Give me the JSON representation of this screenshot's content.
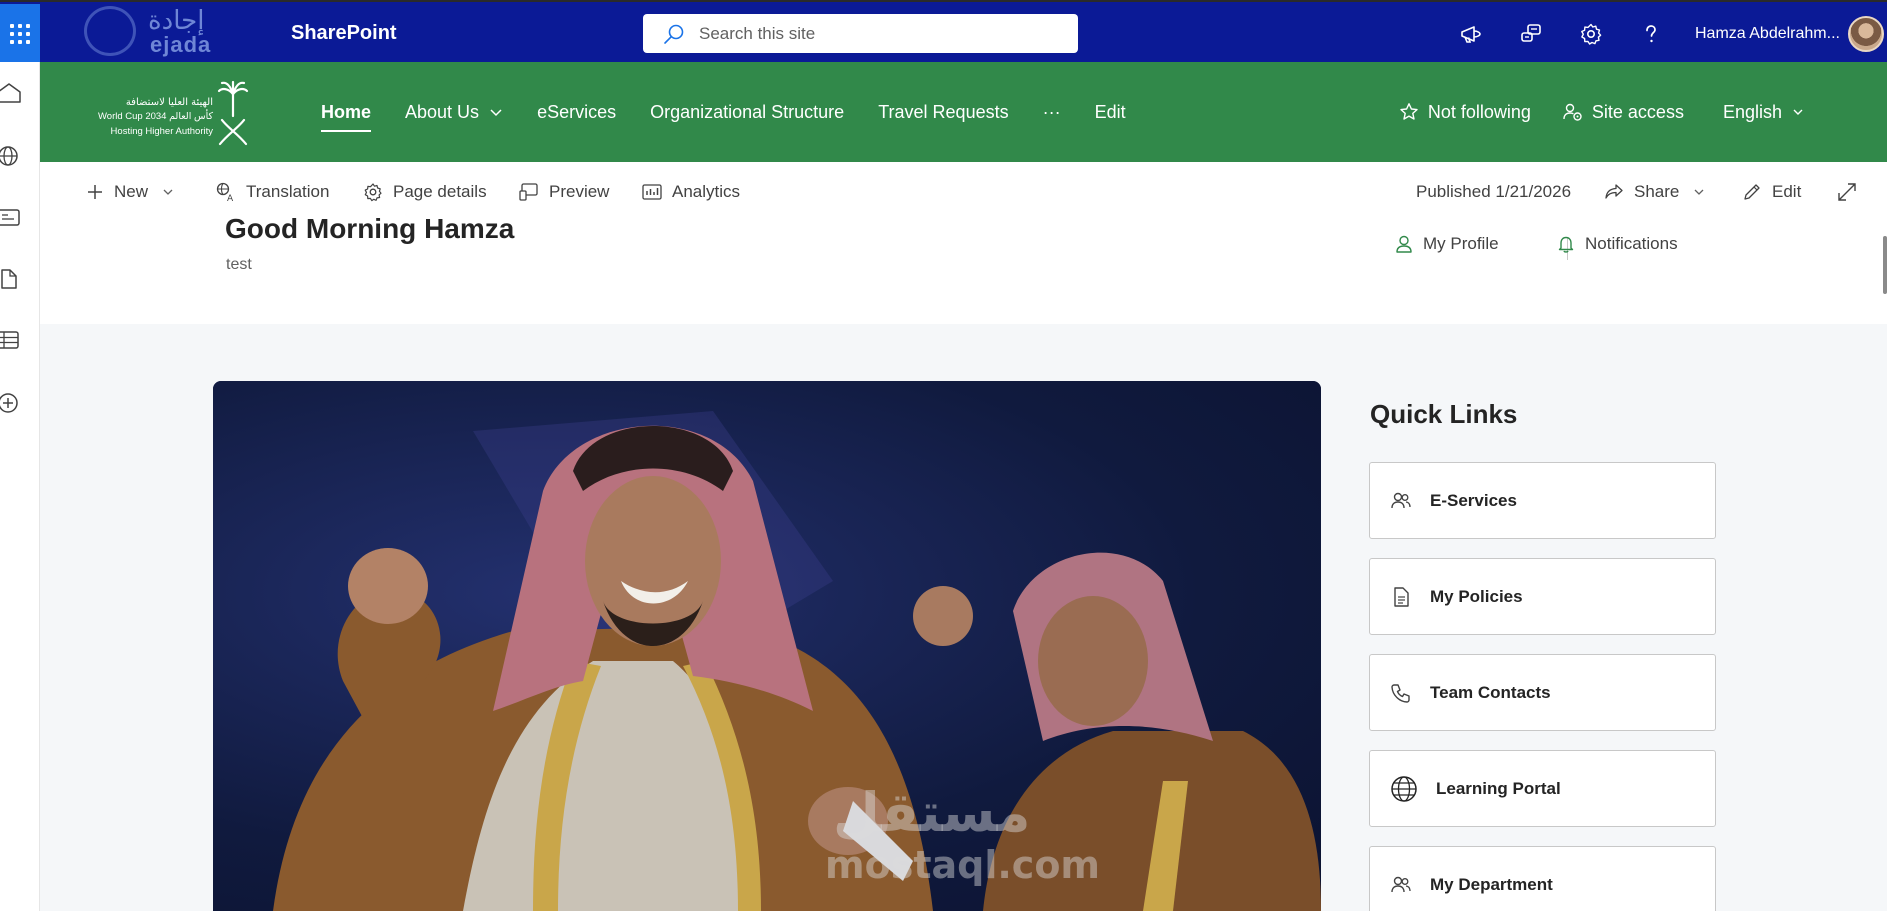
{
  "suite_bar": {
    "app_name": "SharePoint",
    "search_placeholder": "Search this site",
    "user_name": "Hamza Abdelrahm...",
    "brand_logo": {
      "arabic": "إجادة",
      "latin": "ejada"
    },
    "icons": [
      "app-launcher-icon",
      "megaphone-icon",
      "feedback-icon",
      "gear-icon",
      "help-icon"
    ]
  },
  "site": {
    "logo": {
      "arabic": "الهيئة العليا لاستضافة",
      "line2": "World Cup 2034 كأس العالم",
      "line3": "Hosting Higher Authority"
    },
    "nav": [
      {
        "label": "Home",
        "active": true
      },
      {
        "label": "About Us",
        "has_dropdown": true
      },
      {
        "label": "eServices"
      },
      {
        "label": "Organizational Structure"
      },
      {
        "label": "Travel Requests"
      },
      {
        "label": "···"
      },
      {
        "label": "Edit"
      }
    ],
    "not_following": "Not following",
    "site_access": "Site access",
    "language": "English"
  },
  "command_bar": {
    "new": "New",
    "translation": "Translation",
    "page_details": "Page details",
    "preview": "Preview",
    "analytics": "Analytics",
    "published": "Published 1/21/2026",
    "share": "Share",
    "edit": "Edit"
  },
  "header": {
    "greeting": "Good Morning Hamza",
    "subtitle": "test",
    "my_profile": "My Profile",
    "notifications": "Notifications"
  },
  "quick_links": {
    "title": "Quick Links",
    "items": [
      {
        "label": "E-Services",
        "icon": "people-icon"
      },
      {
        "label": "My Policies",
        "icon": "document-icon"
      },
      {
        "label": "Team Contacts",
        "icon": "phone-icon"
      },
      {
        "label": "Learning Portal",
        "icon": "globe-icon"
      },
      {
        "label": "My Department",
        "icon": "people-icon"
      }
    ]
  },
  "hero": {
    "watermark_ar": "مستقل",
    "watermark_en": "mostaql.com"
  },
  "colors": {
    "suite_bar": "#0b1a96",
    "hub_nav": "#31894a",
    "app_launcher": "#1a73e8",
    "content_bg": "#f5f7f9"
  }
}
